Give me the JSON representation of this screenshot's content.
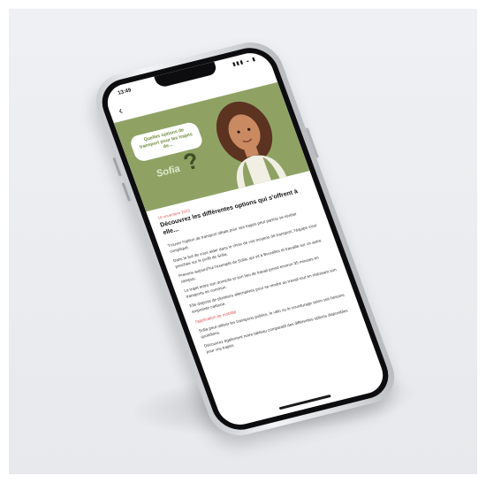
{
  "status": {
    "time": "13:49",
    "icons": "▮▮▮ ◒ ▮"
  },
  "nav": {
    "back_glyph": "‹"
  },
  "hero": {
    "bubble_text": "Quelles options de transport pour les trajets de...",
    "name": "Sofia",
    "question_mark": "?"
  },
  "article": {
    "date": "16 novembre 2023",
    "title": "Découvrez les différentes options qui s'offrent à elle...",
    "paragraphs": [
      "Trouver l'option de transport idéale pour ses trajets peut parfois se révéler compliqué.",
      "Dans le but de vous aider dans le choix de vos moyens de transport, l'équipe s'est penchée sur le profil de Sofia.",
      "Prenons aujourd'hui l'exemple de Sofia, qui vit à Bruxelles et travaille sur un autre campus.",
      "Le trajet entre son domicile et son lieu de travail prend environ 35 minutes en transports en commun.",
      "Elle dispose de plusieurs alternatives pour se rendre au travail tout en réduisant son empreinte carbone.",
      "Sofia peut utiliser les transports publics, le vélo ou le covoiturage selon ses besoins quotidiens."
    ],
    "link_text": "l'application de mobilité",
    "closing": "Découvrez également notre tableau comparatif des différentes options disponibles pour vos trajets."
  },
  "colors": {
    "hero_bg": "#8fa264",
    "accent": "#d94b4b"
  }
}
